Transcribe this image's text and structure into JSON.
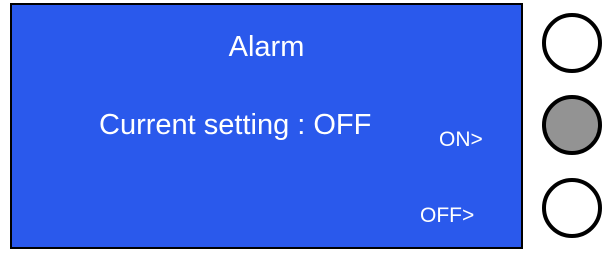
{
  "screen": {
    "title": "Alarm",
    "current_setting": "Current setting : OFF",
    "options": {
      "on_label": "ON>",
      "off_label": "OFF>"
    }
  },
  "colors": {
    "screen_background": "#2a59ec",
    "text": "#ffffff",
    "pressed_button": "#939393"
  },
  "buttons": [
    {
      "name": "top-button",
      "state": "released"
    },
    {
      "name": "on-button",
      "state": "pressed"
    },
    {
      "name": "off-button",
      "state": "released"
    }
  ]
}
